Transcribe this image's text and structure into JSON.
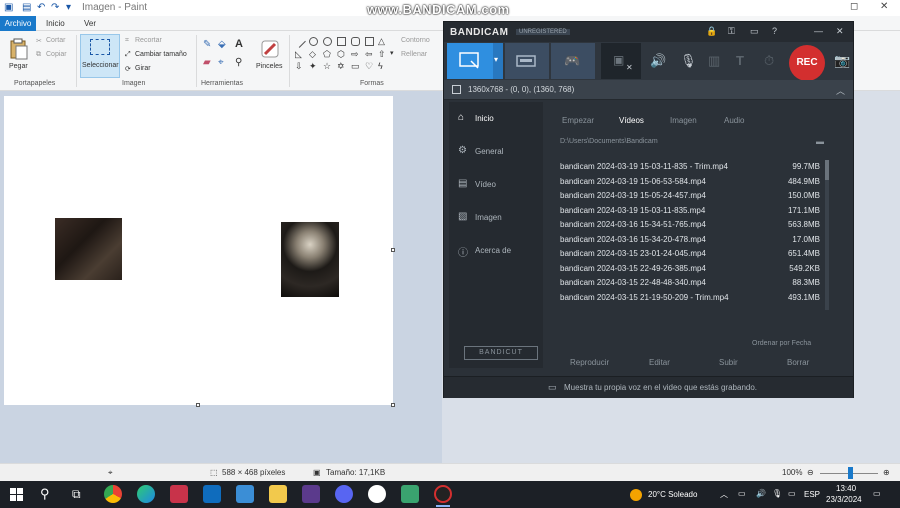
{
  "paint": {
    "title": "Imagen - Paint",
    "menu": {
      "file": "Archivo",
      "tabs": [
        "Inicio",
        "Ver"
      ]
    },
    "clipboard": {
      "paste": "Pegar",
      "cut": "Cortar",
      "copy": "Copiar",
      "group": "Portapapeles"
    },
    "image": {
      "select": "Seleccionar",
      "crop": "Recortar",
      "resize": "Cambiar tamaño",
      "rotate": "Girar",
      "group": "Imagen"
    },
    "tools": {
      "group": "Herramientas",
      "brushes": "Pinceles"
    },
    "shapes": {
      "outline": "Contorno",
      "fill": "Rellenar",
      "group": "Formas"
    },
    "status": {
      "dimensions": "588 × 468 píxeles",
      "size": "Tamaño: 17,1KB",
      "zoom": "100%"
    }
  },
  "watermark": "www.BANDICAM.com",
  "bandicam": {
    "brand": "BANDICAM",
    "registration": "UNREGISTERED",
    "rec_label": "REC",
    "resolution": "1360x768 - (0, 0), (1360, 768)",
    "sidebar": [
      "Inicio",
      "General",
      "Vídeo",
      "Imagen",
      "Acerca de"
    ],
    "bandicut": "BANDICUT",
    "tabs": [
      "Empezar",
      "Vídeos",
      "Imagen",
      "Audio"
    ],
    "path": "D:\\Users\\Documents\\Bandicam",
    "files": [
      {
        "name": "bandicam 2024-03-19 15-03-11-835 - Trim.mp4",
        "size": "99.7MB"
      },
      {
        "name": "bandicam 2024-03-19 15-06-53-584.mp4",
        "size": "484.9MB"
      },
      {
        "name": "bandicam 2024-03-19 15-05-24-457.mp4",
        "size": "150.0MB"
      },
      {
        "name": "bandicam 2024-03-19 15-03-11-835.mp4",
        "size": "171.1MB"
      },
      {
        "name": "bandicam 2024-03-16 15-34-51-765.mp4",
        "size": "563.8MB"
      },
      {
        "name": "bandicam 2024-03-16 15-34-20-478.mp4",
        "size": "17.0MB"
      },
      {
        "name": "bandicam 2024-03-15 23-01-24-045.mp4",
        "size": "651.4MB"
      },
      {
        "name": "bandicam 2024-03-15 22-49-26-385.mp4",
        "size": "549.2KB"
      },
      {
        "name": "bandicam 2024-03-15 22-48-48-340.mp4",
        "size": "88.3MB"
      },
      {
        "name": "bandicam 2024-03-15 21-19-50-209 - Trim.mp4",
        "size": "493.1MB"
      }
    ],
    "sort": "Ordenar por Fecha",
    "actions": [
      "Reproducir",
      "Editar",
      "Subir",
      "Borrar"
    ],
    "footer": "Muestra tu propia voz en el video que estás grabando."
  },
  "taskbar": {
    "weather": "20°C Soleado",
    "lang": "ESP",
    "time": "13:40",
    "date": "23/3/2024"
  },
  "colors": {
    "accent": "#1979ca",
    "bandicam_bg": "#2b3138",
    "rec": "#d32f2f",
    "taskbar": "#1c2026"
  }
}
